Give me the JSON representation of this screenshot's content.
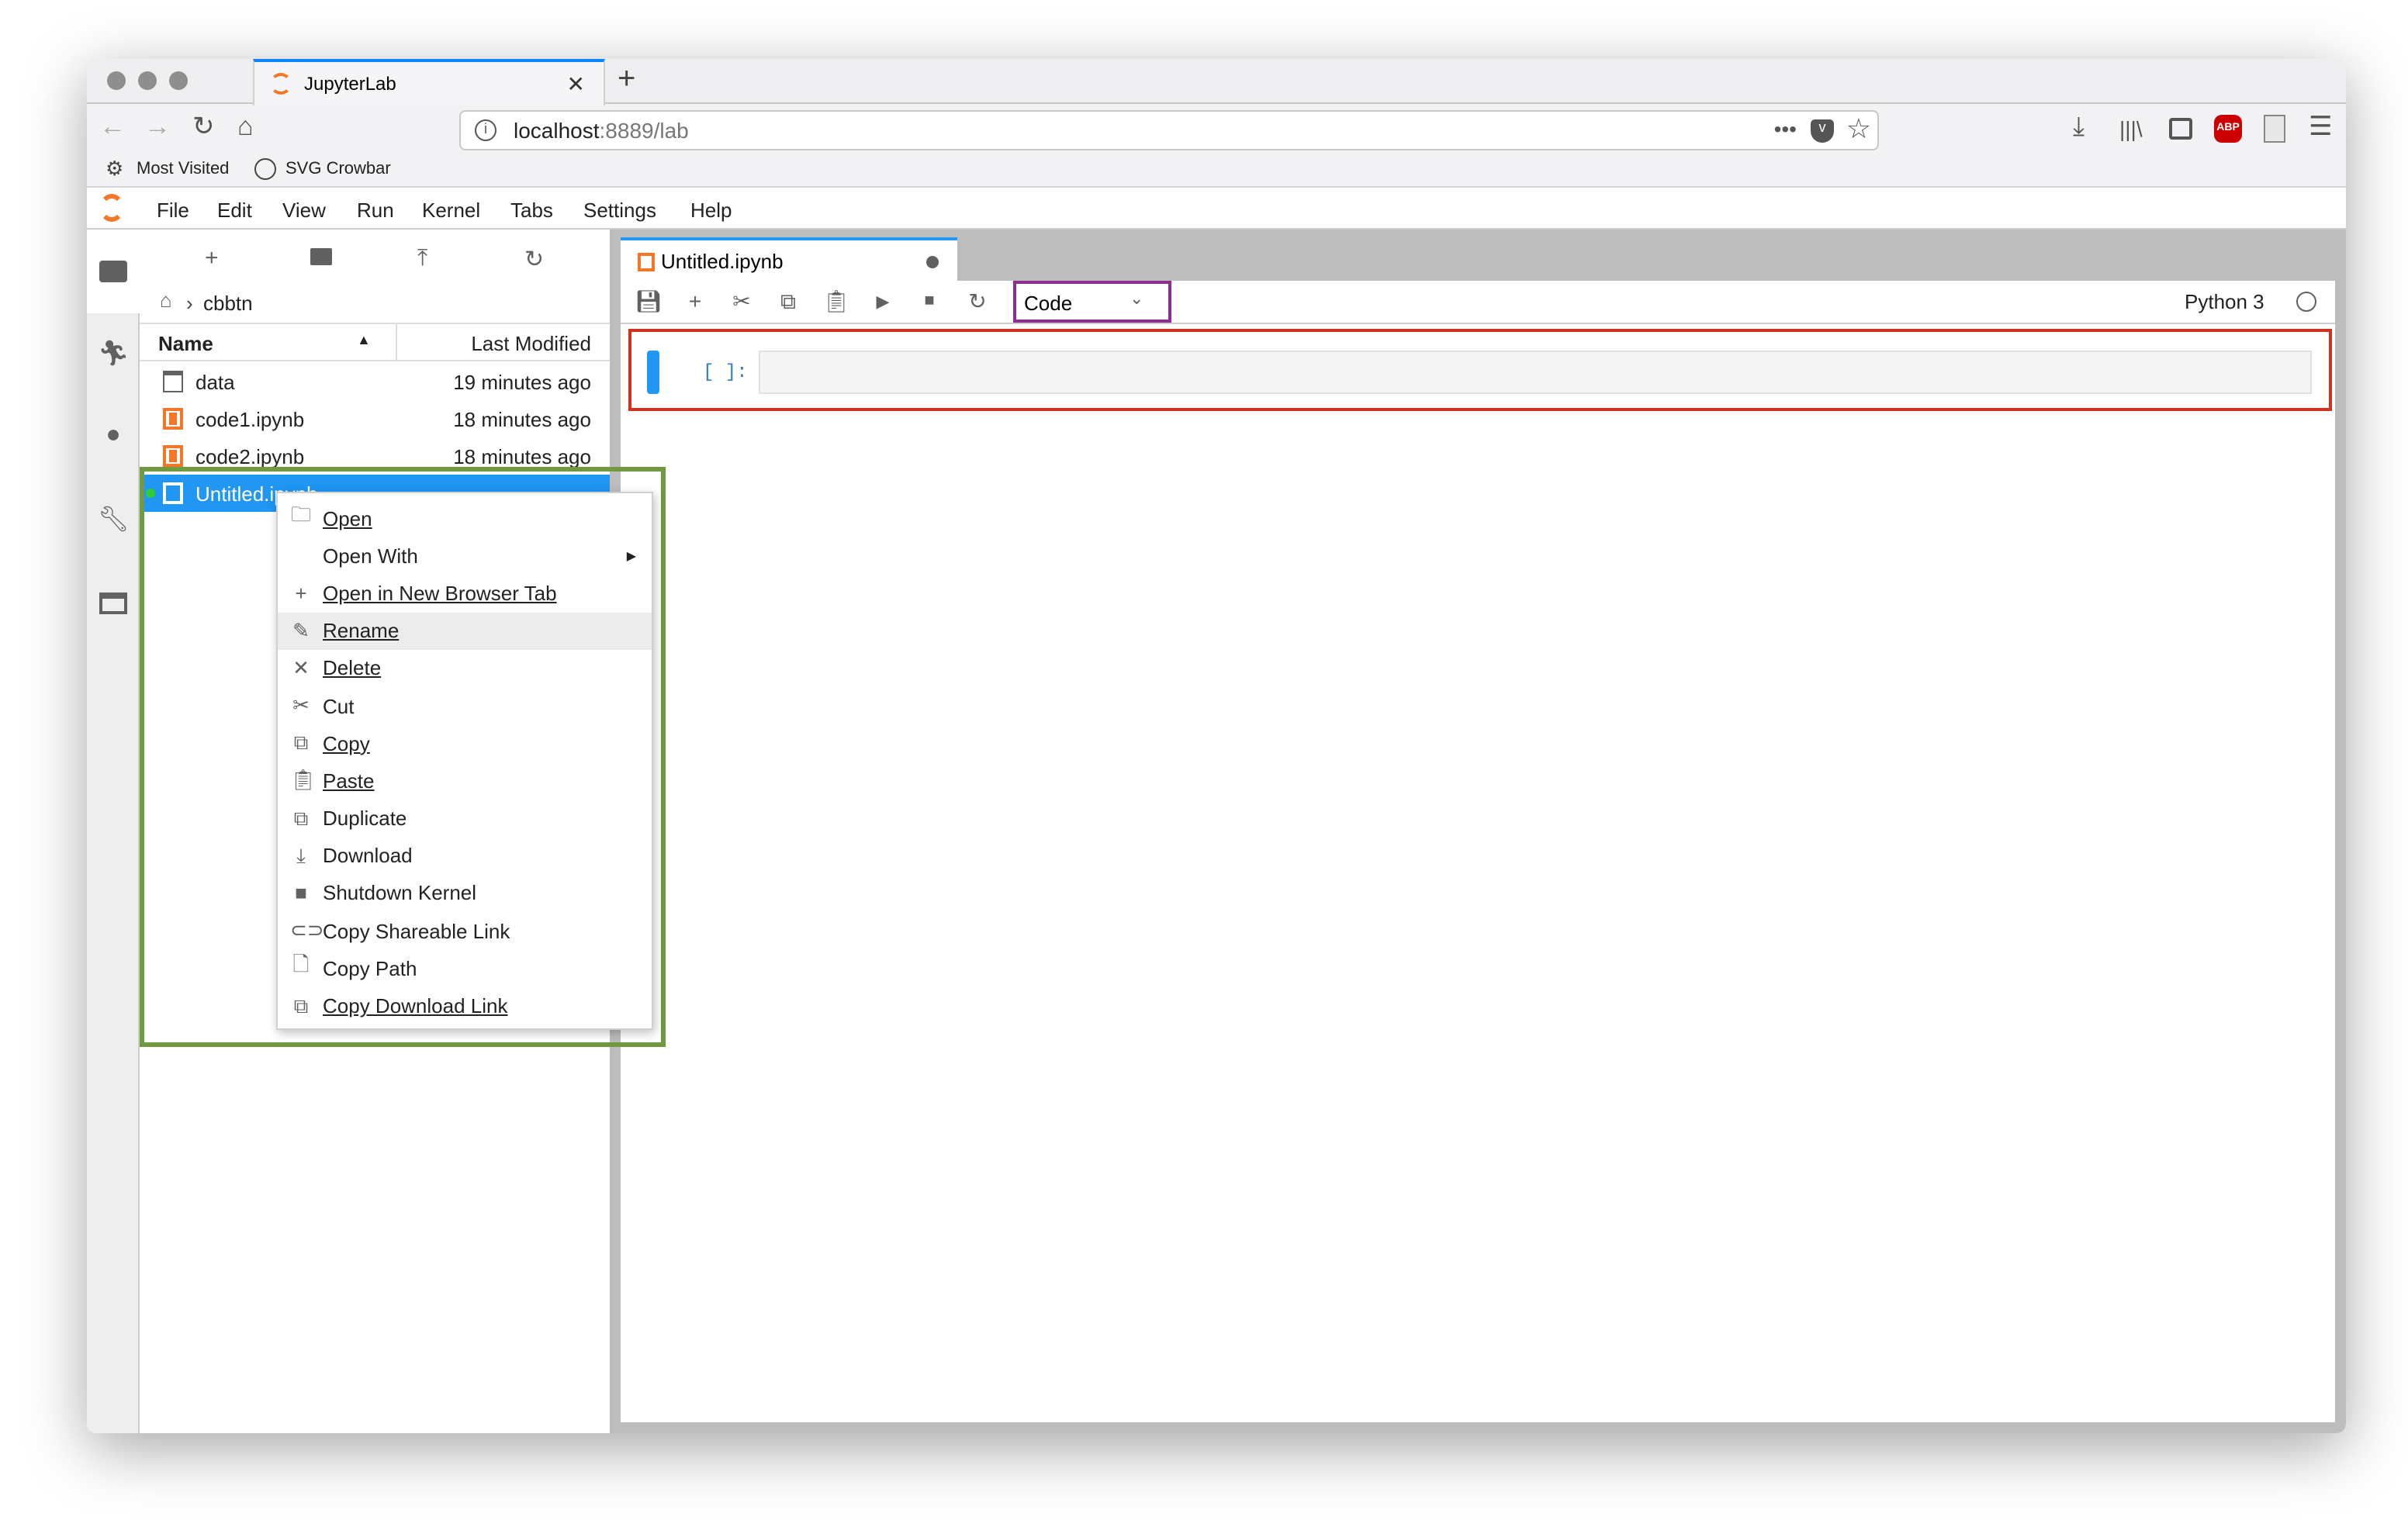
{
  "browser": {
    "tab_title": "JupyterLab",
    "url_host": "localhost",
    "url_rest": ":8889/lab",
    "bookmarks": [
      "Most Visited",
      "SVG Crowbar"
    ],
    "abp_label": "ABP"
  },
  "menubar": [
    "File",
    "Edit",
    "View",
    "Run",
    "Kernel",
    "Tabs",
    "Settings",
    "Help"
  ],
  "filebrowser": {
    "breadcrumb": "cbbtn",
    "col_name": "Name",
    "col_modified": "Last Modified",
    "files": [
      {
        "name": "data",
        "modified": "19 minutes ago",
        "type": "folder"
      },
      {
        "name": "code1.ipynb",
        "modified": "18 minutes ago",
        "type": "notebook"
      },
      {
        "name": "code2.ipynb",
        "modified": "18 minutes ago",
        "type": "notebook"
      },
      {
        "name": "Untitled.ipynb",
        "modified": "",
        "type": "notebook-running",
        "selected": true
      }
    ]
  },
  "notebook": {
    "tab_title": "Untitled.ipynb",
    "cell_type": "Code",
    "kernel": "Python 3",
    "prompt": "[ ]:"
  },
  "context_menu": [
    {
      "label": "Open",
      "icon": "folder-icon"
    },
    {
      "label": "Open With",
      "icon": "",
      "submenu": true
    },
    {
      "label": "Open in New Browser Tab",
      "icon": "plus-icon"
    },
    {
      "label": "Rename",
      "icon": "pencil-icon",
      "highlighted": true
    },
    {
      "label": "Delete",
      "icon": "close-icon"
    },
    {
      "label": "Cut",
      "icon": "scissors-icon"
    },
    {
      "label": "Copy",
      "icon": "copy-icon"
    },
    {
      "label": "Paste",
      "icon": "paste-icon"
    },
    {
      "label": "Duplicate",
      "icon": "copy-icon"
    },
    {
      "label": "Download",
      "icon": "download-icon"
    },
    {
      "label": "Shutdown Kernel",
      "icon": "stop-icon"
    },
    {
      "label": "Copy Shareable Link",
      "icon": "link-icon"
    },
    {
      "label": "Copy Path",
      "icon": "file-icon"
    },
    {
      "label": "Copy Download Link",
      "icon": "copy-icon"
    }
  ],
  "colors": {
    "accent": "#2196f3",
    "highlight_red": "#d0321f",
    "highlight_green": "#6f9a42",
    "highlight_purple": "#8a2f8e",
    "jupyter_orange": "#f37726"
  }
}
